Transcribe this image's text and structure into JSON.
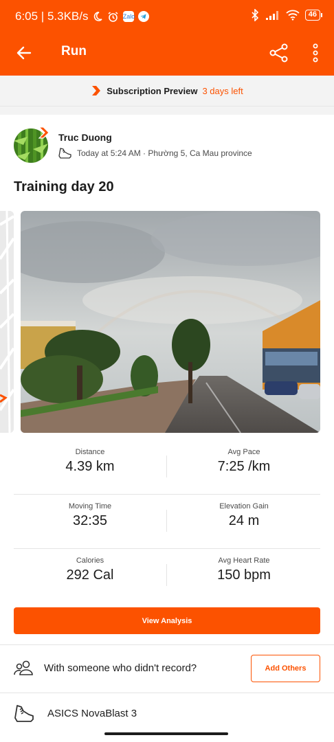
{
  "status_bar": {
    "time_speed": "6:05 | 5.3KB/s",
    "battery": "46",
    "icons": [
      "moon-icon",
      "alarm-icon",
      "zalo-app-icon",
      "telegram-app-icon",
      "bluetooth-icon",
      "signal-icon",
      "wifi-icon",
      "battery-icon"
    ],
    "zalo_label": "Zalo"
  },
  "app_bar": {
    "title": "Run",
    "icons": [
      "back-arrow-icon",
      "share-icon",
      "more-vertical-icon"
    ]
  },
  "subscription": {
    "title": "Subscription Preview",
    "days_left": "3 days left"
  },
  "athlete": {
    "name": "Truc Duong",
    "meta": "Today at 5:24 AM · Phường 5, Ca Mau province"
  },
  "activity": {
    "title": "Training day 20"
  },
  "stats": [
    {
      "left": {
        "label": "Distance",
        "value": "4.39 km"
      },
      "right": {
        "label": "Avg Pace",
        "value": "7:25 /km"
      }
    },
    {
      "left": {
        "label": "Moving Time",
        "value": "32:35"
      },
      "right": {
        "label": "Elevation Gain",
        "value": "24 m"
      }
    },
    {
      "left": {
        "label": "Calories",
        "value": "292 Cal"
      },
      "right": {
        "label": "Avg Heart Rate",
        "value": "150 bpm"
      }
    }
  ],
  "actions": {
    "view_analysis": "View Analysis",
    "with_others_text": "With someone who didn't record?",
    "add_others": "Add Others"
  },
  "gear": {
    "shoe": "ASICS NovaBlast 3"
  },
  "colors": {
    "brand": "#fc5200",
    "text": "#1c1c1c",
    "muted": "#4a4a4a"
  }
}
